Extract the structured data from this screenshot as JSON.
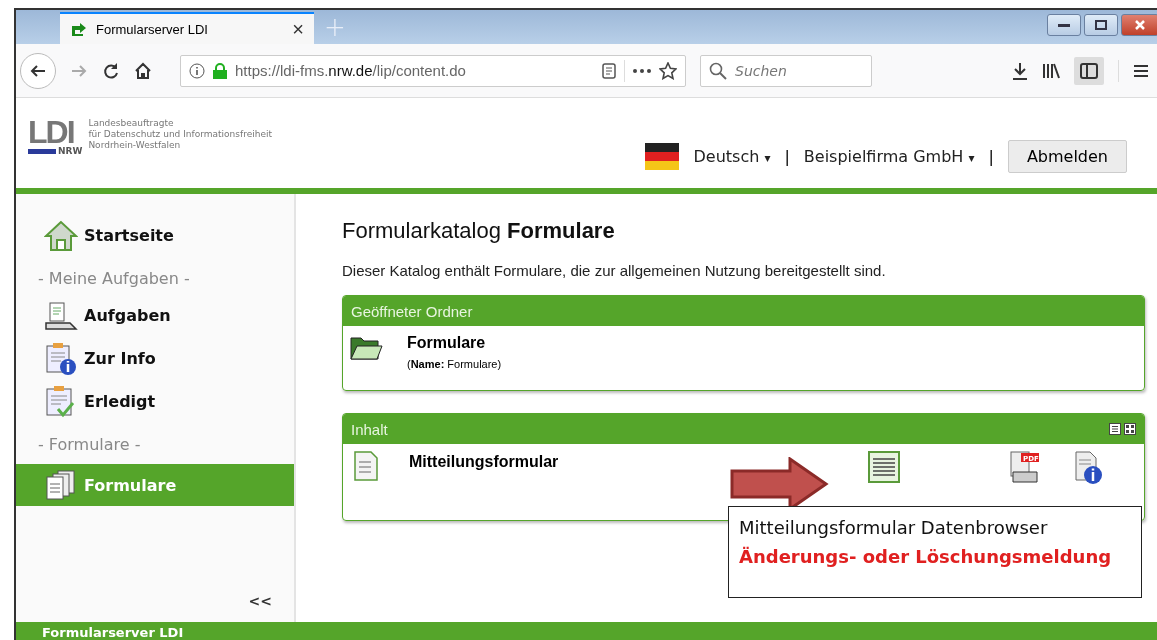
{
  "browser": {
    "tab_title": "Formularserver LDI",
    "tab_close": "×",
    "new_tab": "+",
    "url_prefix": "https://ldi-fms.",
    "url_domain": "nrw.de",
    "url_suffix": "/lip/content.do",
    "search_placeholder": "Suchen"
  },
  "header": {
    "logo": "LDI",
    "logo_region": "NRW",
    "logo_lines": [
      "Landesbeauftragte",
      "für Datenschutz und Informationsfreiheit",
      "Nordrhein-Westfalen"
    ],
    "language": "Deutsch",
    "separator": "|",
    "company": "Beispielfirma GmbH",
    "separator_2": "|",
    "logout": "Abmelden",
    "caret": "▾"
  },
  "sidebar": {
    "items": [
      {
        "kind": "link",
        "label": "Startseite",
        "selected": false
      },
      {
        "kind": "heading",
        "label": "- Meine Aufgaben -"
      },
      {
        "kind": "link",
        "label": "Aufgaben",
        "selected": false
      },
      {
        "kind": "link",
        "label": "Zur Info",
        "selected": false
      },
      {
        "kind": "link",
        "label": "Erledigt",
        "selected": false
      },
      {
        "kind": "heading",
        "label": "- Formulare -"
      },
      {
        "kind": "link",
        "label": "Formulare",
        "selected": true
      }
    ],
    "collapse": "<<"
  },
  "main": {
    "title": "Formularkatalog **Formulare**",
    "description": "Dieser Katalog enthält Formulare, die zur allgemeinen Nutzung bereitgestellt sind.",
    "folder_panel": {
      "header": "Geöffneter Ordner",
      "name": "Formulare",
      "detail": "(**Name:** Formulare)"
    },
    "content_panel": {
      "header": "Inhalt",
      "rows": [
        {
          "name": "Mitteilungsformular",
          "pdf_badge": "PDF"
        }
      ]
    }
  },
  "annotation": {
    "line_1": "Mitteilungsformular Datenbrowser",
    "line_2": "Änderungs- oder Löschungsmeldung"
  },
  "footer": "Formularserver LDI"
}
